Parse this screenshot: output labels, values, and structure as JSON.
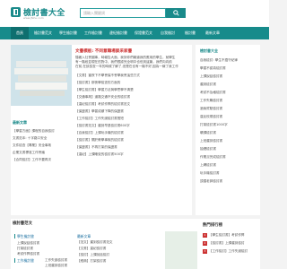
{
  "header": {
    "logo_text": "檢討書大全",
    "logo_url": "www.jfshu.com",
    "search_placeholder": "請輸入關鍵詞",
    "search_icon": "search-icon"
  },
  "nav": {
    "items": [
      "首頁",
      "檢討書范文",
      "學生檢討書",
      "工作檢討書",
      "違紀檢討書",
      "保證書范文",
      "自我檢討",
      "檢討書",
      "最新文章"
    ]
  },
  "featured": {
    "title": "文書模板: 不同意職場談采家書",
    "excerpt_1": "隨著入社會國事，時報告大面，我到你們報道我的應用的學生，就學生",
    "excerpt_2": "有一階段並現在的對中，我們根據完全明中也但到這篇，我們向向前",
    "excerpt_3": "在前,在該檢查一年的時候了解了,但是在也有一機不好,因為一線了我工作"
  },
  "main_list": [
    "【文書】當夜下不學會保不會學我會這些方式",
    "【檢討書】那夜學檢查的方面的",
    "【學生檢討書】學習方法與學思學不清楚",
    "【交通事故】道路交通不安全的檢討書",
    "【違紀檢討書】考試作弊的檢討書范文",
    "【保證書】學習成績下降的保證書",
    "【工作檢討】工作失誤檢討書簡短",
    "【檢討書范文】遲到早退檢討書600字",
    "【自我檢討】上課玩手機的檢討書",
    "【檢討書】關於教學事故的檢討書",
    "【保證書】不再打架的保證書",
    "【違紀】上課睡覺的檢討書500字"
  ],
  "right_panel": {
    "title": "檢討書大全",
    "items": [
      "自我檢討: 學生不遵守紀律",
      "學習不認真檢討書",
      "上課說話檢討書",
      "遲到檢討書",
      "考試不及格檢討書",
      "工作失職檢討書",
      "酒後駕駛檢討書",
      "違反校規檢討書",
      "打架檢討書1000字",
      "曠課檢討書",
      "上班遲到檢討書",
      "抽煙檢討書",
      "作業沒完成檢討書",
      "上網檢討書",
      "玩手機檢討書",
      "頂撞老師檢討書"
    ]
  },
  "left_small": {
    "title": "最新文章",
    "items": [
      "【學習方面】課程的自我檢討",
      "文書范本: 十字路口安全",
      "文件檢查【專業】安全事故",
      "企業文書標准工作會議",
      "【合同檢討】工作不要再次"
    ]
  },
  "bottom": {
    "section_title": "檢討書范文",
    "col1_head": "學生檢討書",
    "col2_head": "最新文章",
    "col2_items": [
      "【范文】遲到檢討書范文",
      "【文書】違紀檢討書",
      "【檢討】上課說話檢討",
      "【經典】打架檢討書"
    ],
    "col3_head": "熱門排行榜",
    "rank_items": [
      "【學生檢討書】考試作弊",
      "【檢討書】上課遲到檢討",
      "【工作檢討】工作失誤檢討"
    ],
    "col1_items": [
      "上課說話檢討書",
      "打架檢討書",
      "考試作弊檢討書"
    ],
    "col1_b_head": "工作檢討書",
    "col1_b_items": [
      "工作失誤檢討書",
      "上班遲到檢討書"
    ]
  },
  "colors": {
    "accent": "#178b8b",
    "accent_dark": "#0e6f6f",
    "highlight_red": "#cc3333"
  }
}
